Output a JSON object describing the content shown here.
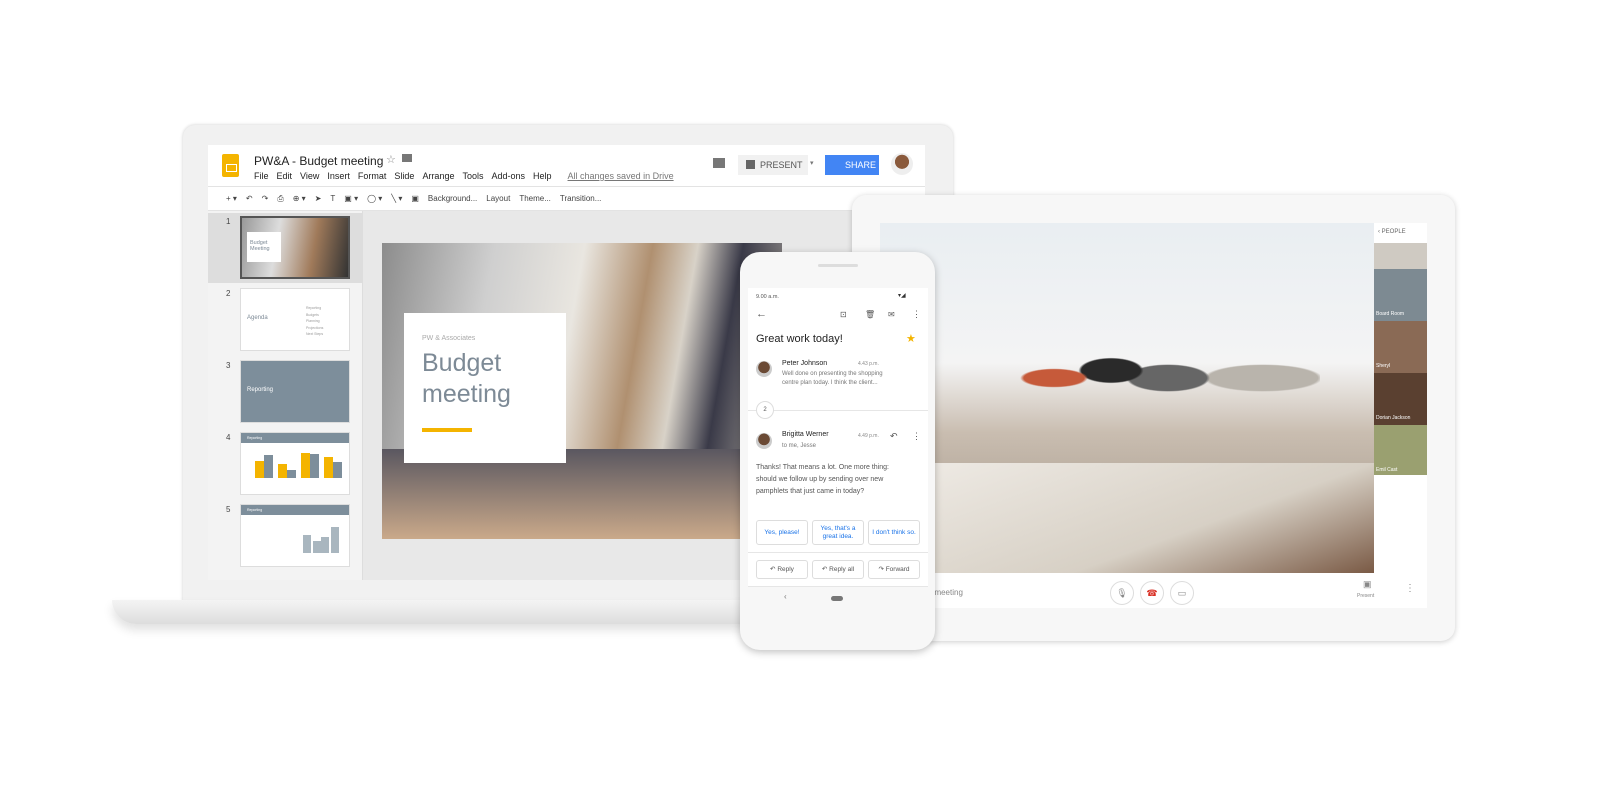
{
  "slides_app": {
    "doc_title": "PW&A - Budget meeting",
    "menu": [
      "File",
      "Edit",
      "View",
      "Insert",
      "Format",
      "Slide",
      "Arrange",
      "Tools",
      "Add-ons",
      "Help"
    ],
    "save_status": "All changes saved in Drive",
    "present_label": "PRESENT",
    "share_label": "SHARE",
    "toolbar": [
      "Background...",
      "Layout",
      "Theme...",
      "Transition..."
    ],
    "thumbnails": [
      {
        "num": "1",
        "title": "Budget Meeting"
      },
      {
        "num": "2",
        "title": "Agenda",
        "items": [
          "Reporting",
          "Budgets",
          "Planning",
          "Projections",
          "Next Steps"
        ]
      },
      {
        "num": "3",
        "title": "Reporting"
      },
      {
        "num": "4",
        "title": "Reporting"
      },
      {
        "num": "5",
        "title": "Reporting"
      }
    ],
    "slide": {
      "subtitle": "PW & Associates",
      "title_line1": "Budget",
      "title_line2": "meeting"
    },
    "accent": "#f4b400"
  },
  "phone_mail": {
    "time": "9.00 a.m.",
    "subject": "Great work today!",
    "messages": [
      {
        "sender": "Peter Johnson",
        "time": "4.43 p.m.",
        "preview_line1": "Well done on presenting the shopping",
        "preview_line2": "centre plan today. I think the client..."
      },
      {
        "sender": "Brigitta Werner",
        "time": "4.49 p.m.",
        "to": "to me, Jesse",
        "body_line1": "Thanks! That means a lot. One more thing:",
        "body_line2": "should we follow up by sending over new",
        "body_line3": "pamphlets that just came in today?"
      }
    ],
    "collapsed_count": "2",
    "smart_replies": [
      "Yes, please!",
      "Yes, that's a great idea.",
      "I don't think so."
    ],
    "actions": [
      "Reply",
      "Reply all",
      "Forward"
    ],
    "link_color": "#1a73e8"
  },
  "meet": {
    "panel_title": "PEOPLE",
    "participants": [
      "Board Room",
      "Sheryl",
      "Dorian Jackson",
      "Emil Cast"
    ],
    "meeting_name": "t meeting",
    "present_label": "Present"
  }
}
